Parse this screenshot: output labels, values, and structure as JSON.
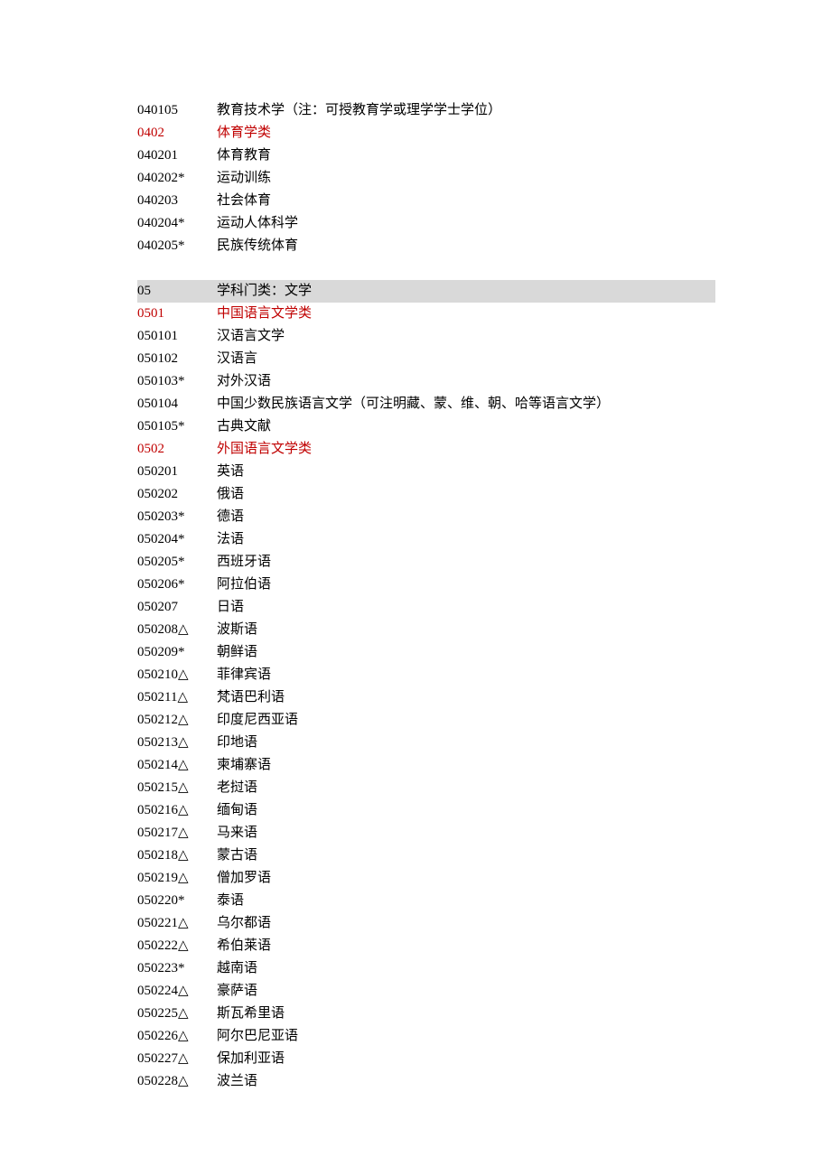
{
  "rows": [
    {
      "code": "040105",
      "name": "教育技术学（注：可授教育学或理学学士学位）",
      "type": "normal"
    },
    {
      "code": "0402",
      "name": "体育学类",
      "type": "red"
    },
    {
      "code": "040201",
      "name": "体育教育",
      "type": "normal"
    },
    {
      "code": "040202*",
      "name": "运动训练",
      "type": "normal"
    },
    {
      "code": "040203",
      "name": "社会体育",
      "type": "normal"
    },
    {
      "code": "040204*",
      "name": "运动人体科学",
      "type": "normal"
    },
    {
      "code": "040205*",
      "name": "民族传统体育",
      "type": "normal"
    },
    {
      "type": "gap"
    },
    {
      "code": "05",
      "name": "学科门类：文学",
      "type": "section"
    },
    {
      "code": "0501",
      "name": "中国语言文学类",
      "type": "red"
    },
    {
      "code": "050101",
      "name": "汉语言文学",
      "type": "normal"
    },
    {
      "code": "050102",
      "name": "汉语言",
      "type": "normal"
    },
    {
      "code": "050103*",
      "name": "对外汉语",
      "type": "normal"
    },
    {
      "code": "050104",
      "name": "中国少数民族语言文学（可注明藏、蒙、维、朝、哈等语言文学）",
      "type": "normal"
    },
    {
      "code": "050105*",
      "name": "古典文献",
      "type": "normal"
    },
    {
      "code": "0502",
      "name": "外国语言文学类",
      "type": "red"
    },
    {
      "code": "050201",
      "name": "英语",
      "type": "normal"
    },
    {
      "code": "050202",
      "name": "俄语",
      "type": "normal"
    },
    {
      "code": "050203*",
      "name": "德语",
      "type": "normal"
    },
    {
      "code": "050204*",
      "name": "法语",
      "type": "normal"
    },
    {
      "code": "050205*",
      "name": "西班牙语",
      "type": "normal"
    },
    {
      "code": "050206*",
      "name": "阿拉伯语",
      "type": "normal"
    },
    {
      "code": "050207",
      "name": "日语",
      "type": "normal"
    },
    {
      "code": "050208△",
      "name": "波斯语",
      "type": "normal"
    },
    {
      "code": "050209*",
      "name": "朝鲜语",
      "type": "normal"
    },
    {
      "code": "050210△",
      "name": "菲律宾语",
      "type": "normal"
    },
    {
      "code": "050211△",
      "name": "梵语巴利语",
      "type": "normal"
    },
    {
      "code": "050212△",
      "name": "印度尼西亚语",
      "type": "normal"
    },
    {
      "code": "050213△",
      "name": "印地语",
      "type": "normal"
    },
    {
      "code": "050214△",
      "name": "柬埔寨语",
      "type": "normal"
    },
    {
      "code": "050215△",
      "name": "老挝语",
      "type": "normal"
    },
    {
      "code": "050216△",
      "name": "缅甸语",
      "type": "normal"
    },
    {
      "code": "050217△",
      "name": "马来语",
      "type": "normal"
    },
    {
      "code": "050218△",
      "name": "蒙古语",
      "type": "normal"
    },
    {
      "code": "050219△",
      "name": "僧加罗语",
      "type": "normal"
    },
    {
      "code": "050220*",
      "name": "泰语",
      "type": "normal"
    },
    {
      "code": "050221△",
      "name": "乌尔都语",
      "type": "normal"
    },
    {
      "code": "050222△",
      "name": "希伯莱语",
      "type": "normal"
    },
    {
      "code": "050223*",
      "name": "越南语",
      "type": "normal"
    },
    {
      "code": "050224△",
      "name": "豪萨语",
      "type": "normal"
    },
    {
      "code": "050225△",
      "name": "斯瓦希里语",
      "type": "normal"
    },
    {
      "code": "050226△",
      "name": "阿尔巴尼亚语",
      "type": "normal"
    },
    {
      "code": "050227△",
      "name": "保加利亚语",
      "type": "normal"
    },
    {
      "code": "050228△",
      "name": "波兰语",
      "type": "normal"
    }
  ]
}
